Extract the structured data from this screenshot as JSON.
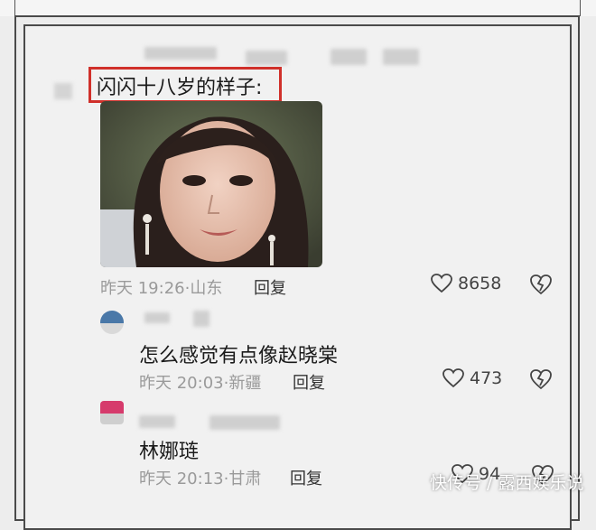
{
  "main_comment": {
    "text": "闪闪十八岁的样子:",
    "time": "昨天 19:26",
    "location": "山东",
    "reply_label": "回复",
    "likes": "8658"
  },
  "replies": [
    {
      "text": "怎么感觉有点像赵晓棠",
      "time": "昨天 20:03",
      "location": "新疆",
      "reply_label": "回复",
      "likes": "473"
    },
    {
      "text": "林娜琏",
      "time": "昨天 20:13",
      "location": "甘肃",
      "reply_label": "回复",
      "likes": "94"
    }
  ],
  "watermark": "快传号 / 露西娱乐说",
  "colors": {
    "highlight": "#d0302a",
    "meta": "#9a9a9a",
    "background": "#f1f1f1"
  },
  "icons": [
    "heart-icon",
    "broken-heart-icon"
  ]
}
